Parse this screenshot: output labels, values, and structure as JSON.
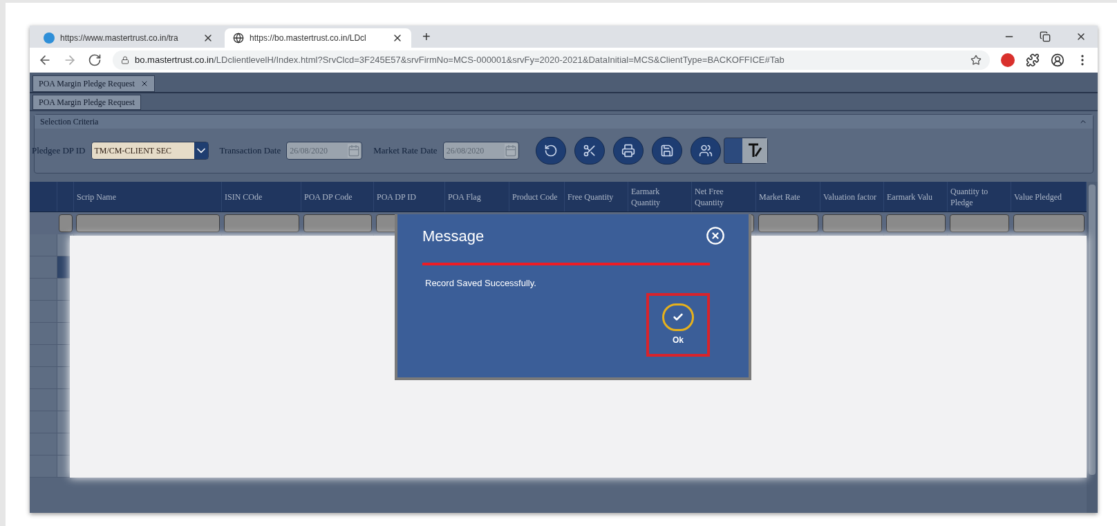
{
  "browser": {
    "tabs": [
      {
        "title": "https://www.mastertrust.co.in/tra",
        "selected": false,
        "kind": "site"
      },
      {
        "title": "https://bo.mastertrust.co.in/LDcl",
        "selected": true,
        "kind": "globe"
      }
    ],
    "new_tab": "+",
    "url_host": "bo.mastertrust.co.in",
    "url_path": "/LDclientlevelH/Index.html?SrvClcd=3F245E57&srvFirmNo=MCS-000001&srvFy=2020-2021&DataInitial=MCS&ClientType=BACKOFFICE#Tab"
  },
  "app": {
    "outer_tab": "POA Margin Pledge Request",
    "inner_tab": "POA Margin Pledge Request",
    "panel_title": "Selection Criteria",
    "text_mode_on": true,
    "fields": [
      {
        "label": "Pledgee DP ID",
        "kind": "dropdown",
        "value": "TM/CM-CLIENT SEC",
        "disabled": false
      },
      {
        "label": "Transaction Date",
        "kind": "date",
        "value": "26/08/2020",
        "disabled": true
      },
      {
        "label": "Market Rate Date",
        "kind": "date",
        "value": "26/08/2020",
        "disabled": true
      }
    ],
    "grid": {
      "columns": [
        "Scrip Name",
        "ISIN COde",
        "POA DP Code",
        "POA DP ID",
        "POA Flag",
        "Product Code",
        "Free Quantity",
        "Earmark Quantity",
        "Net Free Quantity",
        "Market Rate",
        "Valuation factor",
        "Earmark Valu",
        "Quantity to Pledge",
        "Value Pledged"
      ],
      "rows": [
        {
          "selected": false
        },
        {
          "selected": true
        },
        {
          "selected": false
        },
        {
          "selected": false
        },
        {
          "selected": false
        },
        {
          "selected": false
        },
        {
          "selected": false
        },
        {
          "selected": false
        },
        {
          "selected": false
        },
        {
          "selected": false
        },
        {
          "selected": false
        }
      ]
    }
  },
  "dialog": {
    "title": "Message",
    "message": "Record Saved Successfully.",
    "ok_label": "Ok",
    "ok_highlighted": true
  }
}
